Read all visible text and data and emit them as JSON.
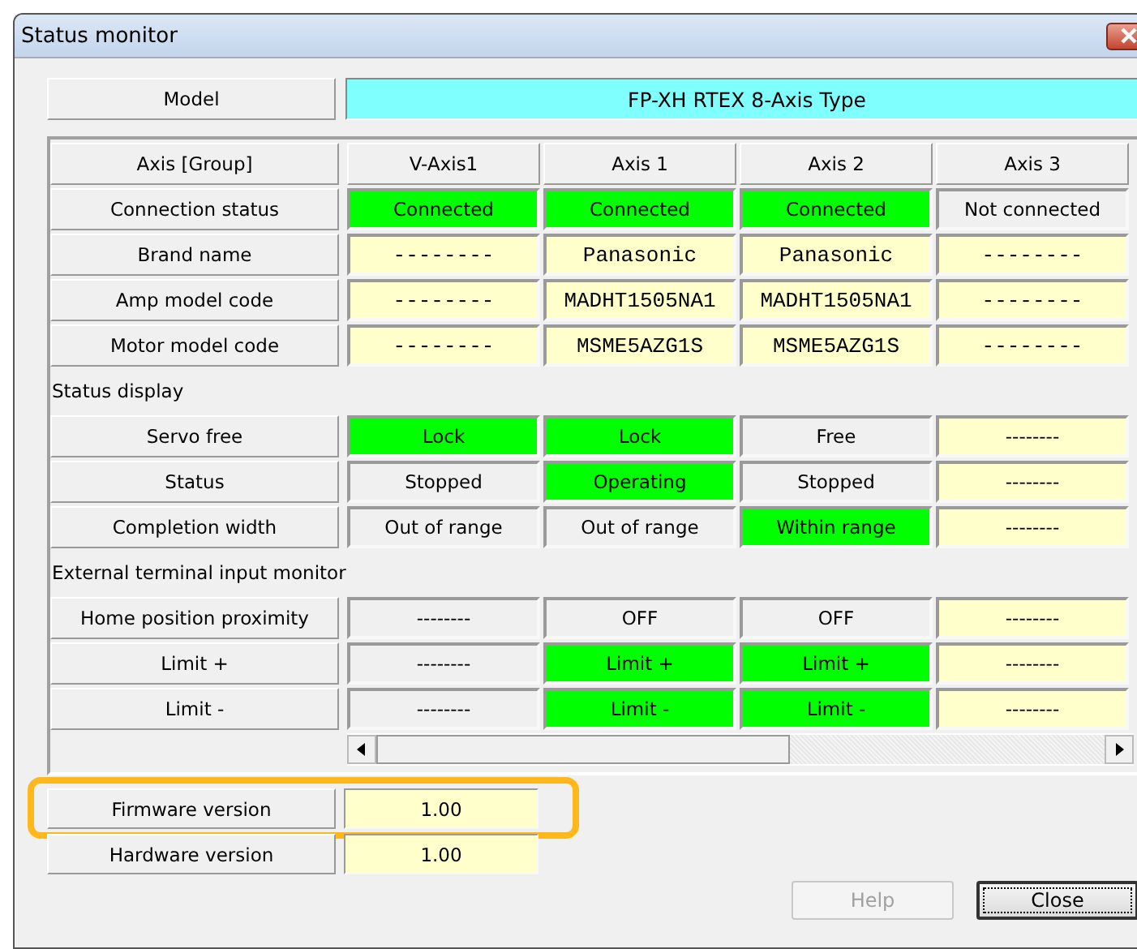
{
  "window": {
    "title": "Status monitor"
  },
  "model": {
    "label": "Model",
    "value": "FP-XH RTEX 8-Axis Type"
  },
  "grid": {
    "header": {
      "label": "Axis [Group]",
      "columns": [
        "V-Axis1",
        "Axis 1",
        "Axis 2",
        "Axis 3"
      ]
    },
    "rows": [
      {
        "kind": "row",
        "label": "Connection status",
        "cells": [
          {
            "text": "Connected",
            "active": true,
            "empty": false
          },
          {
            "text": "Connected",
            "active": true,
            "empty": false
          },
          {
            "text": "Connected",
            "active": true,
            "empty": false
          },
          {
            "text": "Not connected",
            "active": false,
            "empty": false
          }
        ]
      },
      {
        "kind": "code",
        "label": "Brand name",
        "cells": [
          {
            "text": "--------",
            "active": false,
            "empty": true
          },
          {
            "text": "Panasonic",
            "active": false,
            "empty": true
          },
          {
            "text": "Panasonic",
            "active": false,
            "empty": true
          },
          {
            "text": "--------",
            "active": false,
            "empty": true
          }
        ]
      },
      {
        "kind": "code",
        "label": "Amp model code",
        "cells": [
          {
            "text": "--------",
            "active": false,
            "empty": true
          },
          {
            "text": "MADHT1505NA1",
            "active": false,
            "empty": true
          },
          {
            "text": "MADHT1505NA1",
            "active": false,
            "empty": true
          },
          {
            "text": "--------",
            "active": false,
            "empty": true
          }
        ]
      },
      {
        "kind": "code",
        "label": "Motor model code",
        "cells": [
          {
            "text": "--------",
            "active": false,
            "empty": true
          },
          {
            "text": "MSME5AZG1S",
            "active": false,
            "empty": true
          },
          {
            "text": "MSME5AZG1S",
            "active": false,
            "empty": true
          },
          {
            "text": "--------",
            "active": false,
            "empty": true
          }
        ]
      },
      {
        "kind": "section",
        "label": "Status display"
      },
      {
        "kind": "row",
        "label": "Servo free",
        "cells": [
          {
            "text": "Lock",
            "active": true,
            "empty": false
          },
          {
            "text": "Lock",
            "active": true,
            "empty": false
          },
          {
            "text": "Free",
            "active": false,
            "empty": false
          },
          {
            "text": "--------",
            "active": false,
            "empty": true
          }
        ]
      },
      {
        "kind": "row",
        "label": "Status",
        "cells": [
          {
            "text": "Stopped",
            "active": false,
            "empty": false
          },
          {
            "text": "Operating",
            "active": true,
            "empty": false
          },
          {
            "text": "Stopped",
            "active": false,
            "empty": false
          },
          {
            "text": "--------",
            "active": false,
            "empty": true
          }
        ]
      },
      {
        "kind": "row",
        "label": "Completion width",
        "cells": [
          {
            "text": "Out of range",
            "active": false,
            "empty": false
          },
          {
            "text": "Out of range",
            "active": false,
            "empty": false
          },
          {
            "text": "Within range",
            "active": true,
            "empty": false
          },
          {
            "text": "--------",
            "active": false,
            "empty": true
          }
        ]
      },
      {
        "kind": "section",
        "label": "External terminal input monitor"
      },
      {
        "kind": "row",
        "label": "Home position proximity",
        "cells": [
          {
            "text": "--------",
            "active": false,
            "empty": false
          },
          {
            "text": "OFF",
            "active": false,
            "empty": false
          },
          {
            "text": "OFF",
            "active": false,
            "empty": false
          },
          {
            "text": "--------",
            "active": false,
            "empty": true
          }
        ]
      },
      {
        "kind": "row",
        "label": "Limit +",
        "cells": [
          {
            "text": "--------",
            "active": false,
            "empty": false
          },
          {
            "text": "Limit +",
            "active": true,
            "empty": false
          },
          {
            "text": "Limit +",
            "active": true,
            "empty": false
          },
          {
            "text": "--------",
            "active": false,
            "empty": true
          }
        ]
      },
      {
        "kind": "row",
        "label": "Limit -",
        "cells": [
          {
            "text": "--------",
            "active": false,
            "empty": false
          },
          {
            "text": "Limit -",
            "active": true,
            "empty": false
          },
          {
            "text": "Limit -",
            "active": true,
            "empty": false
          },
          {
            "text": "--------",
            "active": false,
            "empty": true
          }
        ]
      }
    ]
  },
  "versions": [
    {
      "label": "Firmware version",
      "value": "1.00",
      "highlighted": true
    },
    {
      "label": "Hardware version",
      "value": "1.00",
      "highlighted": false
    }
  ],
  "buttons": [
    {
      "label": "Help",
      "disabled": true,
      "focused": false
    },
    {
      "label": "Close",
      "disabled": false,
      "focused": true
    }
  ]
}
